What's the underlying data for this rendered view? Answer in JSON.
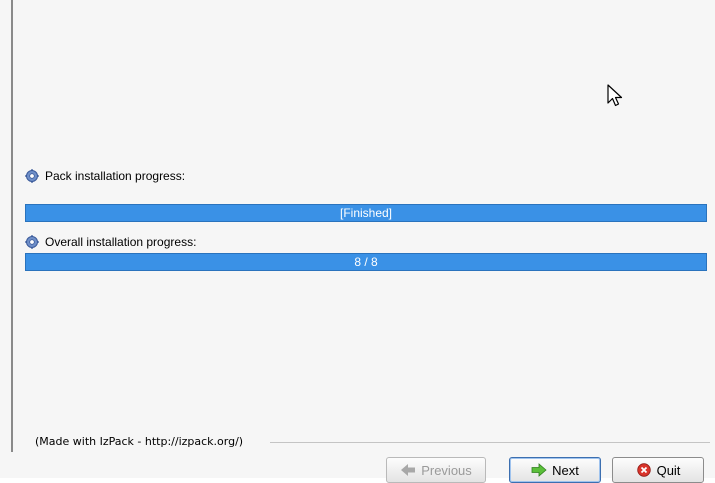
{
  "pack_progress": {
    "label": "Pack installation progress:",
    "status_text": "[Finished]",
    "value": 1.0
  },
  "overall_progress": {
    "label": "Overall installation progress:",
    "status_text": "8 / 8",
    "value": 1.0
  },
  "footer": {
    "credit": "(Made with IzPack - http://izpack.org/)"
  },
  "buttons": {
    "previous": "Previous",
    "next": "Next",
    "quit": "Quit"
  },
  "colors": {
    "progress_fill": "#3a91e6",
    "window_bg": "#f6f6f6"
  },
  "icons": {
    "label_icon": "gear-icon",
    "previous_icon": "arrow-left-icon",
    "next_icon": "arrow-right-icon",
    "quit_icon": "close-circle-icon"
  }
}
